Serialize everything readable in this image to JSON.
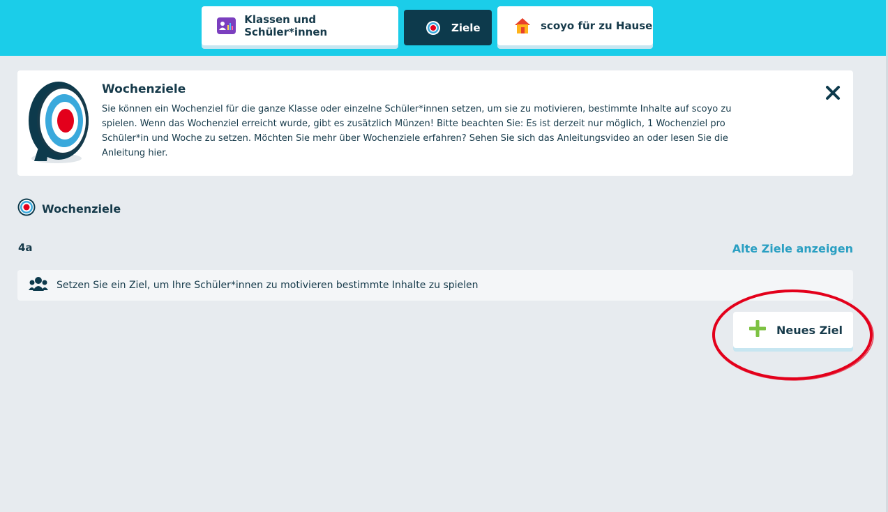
{
  "nav": {
    "tabs": [
      {
        "label": "Klassen und Schüler*innen",
        "icon": "class-card-icon"
      },
      {
        "label": "Ziele",
        "icon": "target-icon",
        "active": true
      },
      {
        "label": "scoyo für zu Hause",
        "icon": "house-icon"
      }
    ]
  },
  "info": {
    "title": "Wochenziele",
    "text": "Sie können ein Wochenziel für die ganze Klasse oder einzelne Schüler*innen setzen, um sie zu motivieren, bestimmte Inhalte auf scoyo zu spielen. Wenn das Wochenziel erreicht wurde, gibt es zusätzlich Münzen! Bitte beachten Sie: Es ist derzeit nur möglich, 1 Wochenziel pro Schüler*in und Woche zu setzen. Möchten Sie mehr über Wochenziele erfahren? Sehen Sie sich das Anleitungsvideo an oder lesen Sie die Anleitung hier."
  },
  "section": {
    "title": "Wochenziele",
    "class_name": "4a",
    "old_goals_link": "Alte Ziele anzeigen",
    "hint": "Setzen Sie ein Ziel, um Ihre Schüler*innen zu motivieren bestimmte Inhalte zu spielen",
    "new_goal_button": "Neues Ziel"
  },
  "colors": {
    "header": "#1bcde9",
    "active_tab": "#0d3a4c",
    "link": "#2a9fc2",
    "plus": "#7dc242",
    "annotation": "#e3001b"
  }
}
